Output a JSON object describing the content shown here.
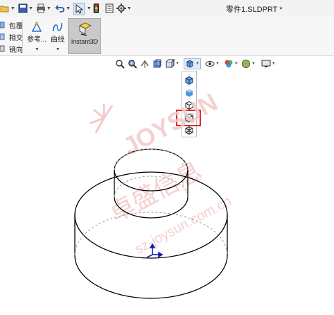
{
  "app": {
    "document_title": "零件1.SLDPRT *"
  },
  "quick_access": {
    "items": [
      "open-icon",
      "save-icon",
      "print-icon",
      "undo-icon",
      "select-icon",
      "traffic-light-icon",
      "file-properties-icon",
      "options-icon"
    ]
  },
  "ribbon": {
    "commands": [
      {
        "label": "包覆",
        "icon": "wrap-icon"
      },
      {
        "label": "相交",
        "icon": "intersect-icon"
      },
      {
        "label": "镜向",
        "icon": "mirror-icon"
      }
    ],
    "reference_label": "参考...",
    "curves_label": "曲线",
    "instant3d_label": "Instant3D"
  },
  "heads_up_toolbar": {
    "items": [
      "zoom-to-fit-icon",
      "zoom-area-icon",
      "previous-view-icon",
      "section-view-icon",
      "view-orientation-icon",
      "display-style-icon",
      "hide-show-items-icon",
      "edit-appearance-icon",
      "apply-scene-icon",
      "view-settings-icon"
    ]
  },
  "display_style_flyout": {
    "options": [
      "shaded-with-edges",
      "shaded",
      "hidden-lines-removed",
      "hidden-lines-visible",
      "wireframe"
    ],
    "highlighted": "hidden-lines-visible"
  },
  "watermark": {
    "brand_latin": "JOYSUN",
    "brand_cn": "卓盛信息",
    "domain": "sz-joysun.com.cn"
  },
  "colors": {
    "highlight": "#e0272b",
    "model_edge": "#000000",
    "hidden_edge": "#9a9a9a",
    "triad_blue": "#1a1ab8",
    "watermark": "#f3c9c9"
  }
}
